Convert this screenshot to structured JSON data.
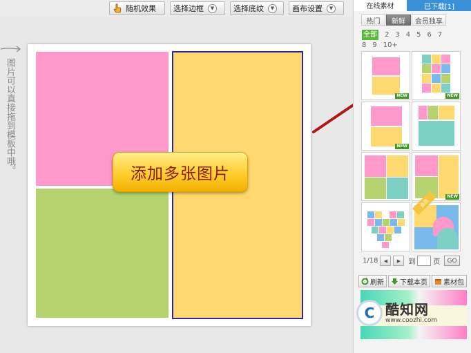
{
  "toolbar": {
    "random_label": "随机效果",
    "border_label": "选择边框",
    "texture_label": "选择底纹",
    "canvas_label": "画布设置"
  },
  "hint": {
    "text": "图片可以直接拖到模板中哦。"
  },
  "canvas": {
    "add_button_label": "添加多张图片",
    "cell_colors": {
      "pink": "#ff99cc",
      "green": "#b5d36f",
      "yellow": "#ffd96f"
    },
    "selected_border_color": "#2b2b9a"
  },
  "panel": {
    "tabs": [
      {
        "label": "在线素材",
        "active": true
      },
      {
        "label": "已下载[1]",
        "active": false
      }
    ],
    "subtabs": [
      {
        "label": "热门",
        "active": false
      },
      {
        "label": "新鲜",
        "active": true
      },
      {
        "label": "会员独享",
        "active": false
      }
    ],
    "counts": [
      "全部",
      "2",
      "3",
      "4",
      "5",
      "6",
      "7",
      "8",
      "9",
      "10+"
    ],
    "active_count": "全部",
    "new_badge": "NEW",
    "vip_badge": "会员",
    "pager": {
      "current": "1/18",
      "goto_label": "到",
      "page_label": "页",
      "go_label": "GO"
    },
    "actions": {
      "refresh_label": "刷新",
      "download_label": "下载本页",
      "pack_label": "素材包"
    }
  },
  "watermark": {
    "name": "酷知网",
    "url": "www.coozhi.com"
  },
  "colors": {
    "accent_blue": "#3a91d8",
    "new_green": "#3d9b1e",
    "arrow_red": "#b01818"
  }
}
